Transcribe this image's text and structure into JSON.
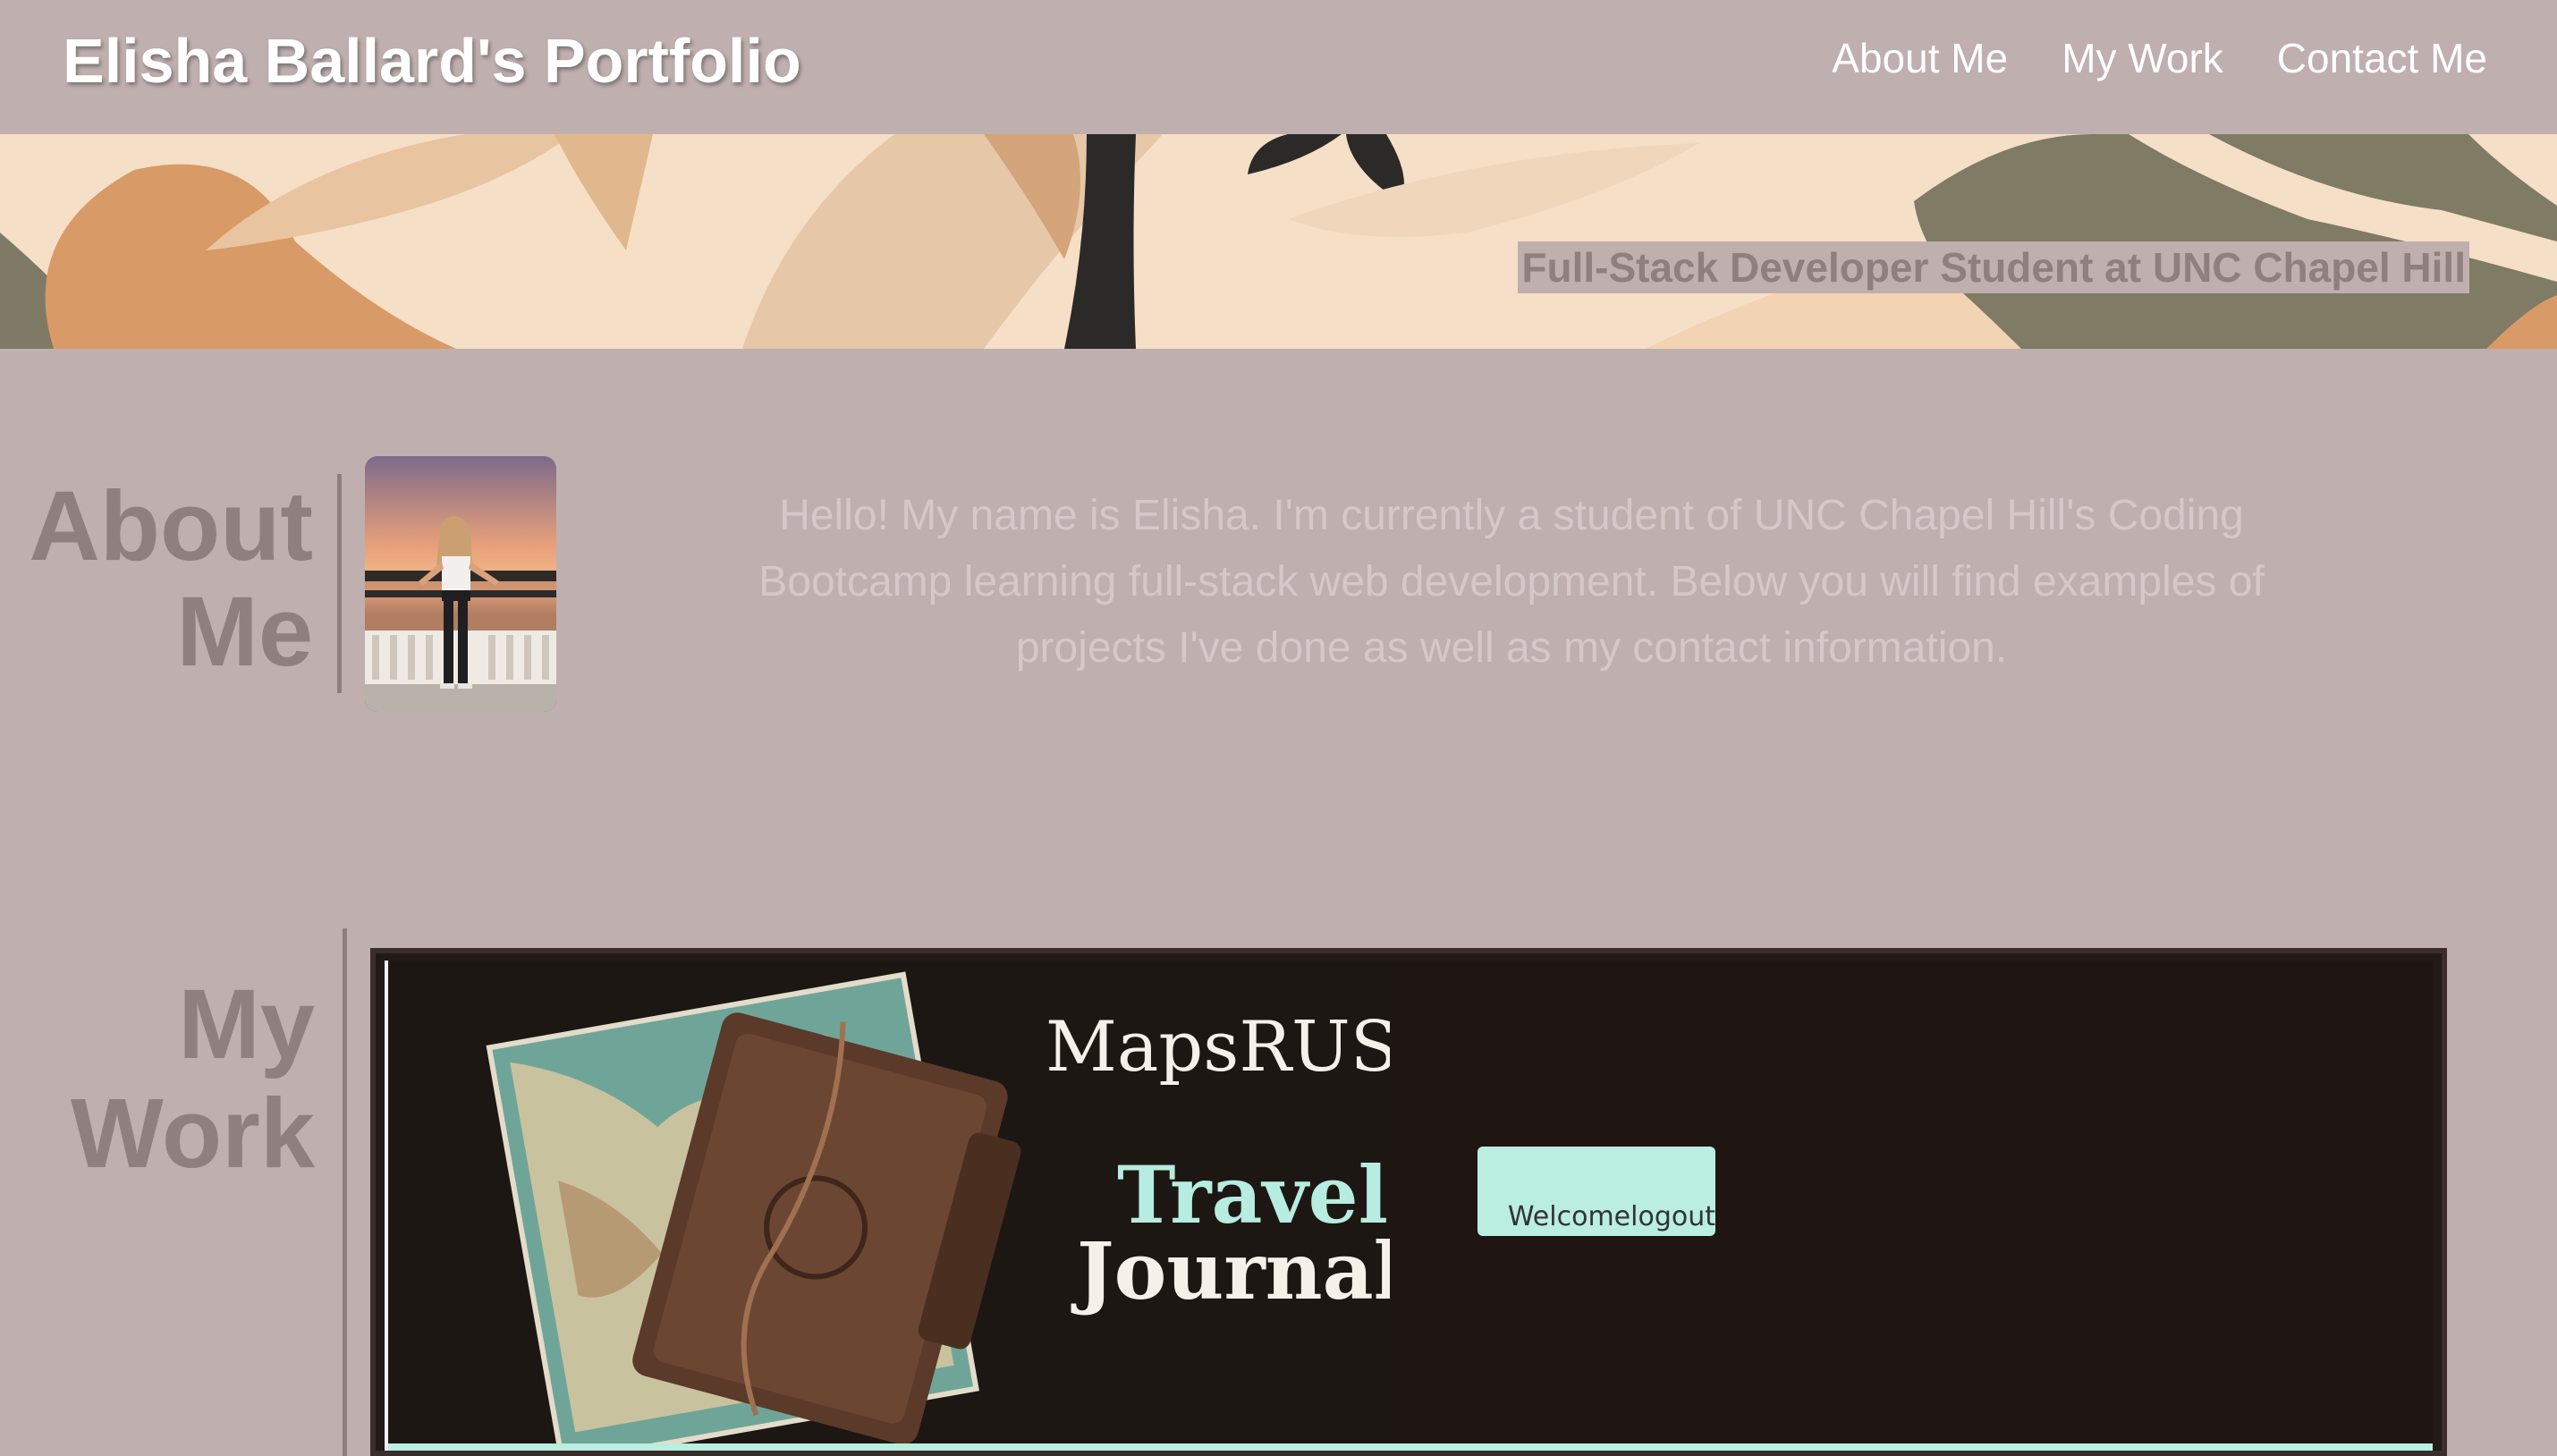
{
  "header": {
    "title": "Elisha Ballard's Portfolio",
    "nav": [
      "About Me",
      "My Work",
      "Contact Me"
    ]
  },
  "hero": {
    "tagline": "Full-Stack Developer Student at UNC Chapel Hill"
  },
  "about": {
    "heading": [
      "About",
      "Me"
    ],
    "text": "Hello! My name is Elisha. I'm currently a student of UNC Chapel Hill's Coding Bootcamp learning full-stack web development. Below you will find examples of projects I've done as well as my contact information."
  },
  "work": {
    "heading": [
      "My",
      "Work"
    ],
    "project": {
      "brand": "MapsRUS",
      "title_line1": "Travel",
      "title_line2": "Journal",
      "button_label": "Welcomelogout"
    }
  },
  "colors": {
    "background": "#bfafaf",
    "heading": "#8f7f7f",
    "accent": "#b9eee0",
    "card": "#231917"
  }
}
